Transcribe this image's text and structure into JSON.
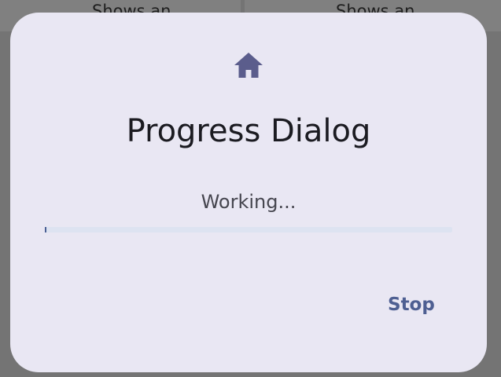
{
  "background": {
    "left_card_text": "Shows an",
    "right_card_text": "Shows an"
  },
  "dialog": {
    "icon": "home-icon",
    "title": "Progress Dialog",
    "message": "Working...",
    "progress_fraction": 0.004,
    "stop_label": "Stop"
  },
  "colors": {
    "scrim": "#747474",
    "dialog_surface": "#e9e7f3",
    "accent": "#4e5f92",
    "progress_track": "#dde3f1",
    "icon": "#5b5d8c"
  }
}
